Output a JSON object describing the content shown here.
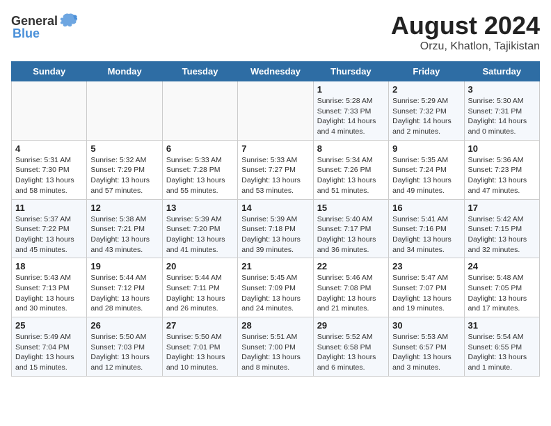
{
  "logo": {
    "text_general": "General",
    "text_blue": "Blue"
  },
  "title": {
    "month_year": "August 2024",
    "location": "Orzu, Khatlon, Tajikistan"
  },
  "days_of_week": [
    "Sunday",
    "Monday",
    "Tuesday",
    "Wednesday",
    "Thursday",
    "Friday",
    "Saturday"
  ],
  "weeks": [
    [
      {
        "day": "",
        "info": ""
      },
      {
        "day": "",
        "info": ""
      },
      {
        "day": "",
        "info": ""
      },
      {
        "day": "",
        "info": ""
      },
      {
        "day": "1",
        "info": "Sunrise: 5:28 AM\nSunset: 7:33 PM\nDaylight: 14 hours\nand 4 minutes."
      },
      {
        "day": "2",
        "info": "Sunrise: 5:29 AM\nSunset: 7:32 PM\nDaylight: 14 hours\nand 2 minutes."
      },
      {
        "day": "3",
        "info": "Sunrise: 5:30 AM\nSunset: 7:31 PM\nDaylight: 14 hours\nand 0 minutes."
      }
    ],
    [
      {
        "day": "4",
        "info": "Sunrise: 5:31 AM\nSunset: 7:30 PM\nDaylight: 13 hours\nand 58 minutes."
      },
      {
        "day": "5",
        "info": "Sunrise: 5:32 AM\nSunset: 7:29 PM\nDaylight: 13 hours\nand 57 minutes."
      },
      {
        "day": "6",
        "info": "Sunrise: 5:33 AM\nSunset: 7:28 PM\nDaylight: 13 hours\nand 55 minutes."
      },
      {
        "day": "7",
        "info": "Sunrise: 5:33 AM\nSunset: 7:27 PM\nDaylight: 13 hours\nand 53 minutes."
      },
      {
        "day": "8",
        "info": "Sunrise: 5:34 AM\nSunset: 7:26 PM\nDaylight: 13 hours\nand 51 minutes."
      },
      {
        "day": "9",
        "info": "Sunrise: 5:35 AM\nSunset: 7:24 PM\nDaylight: 13 hours\nand 49 minutes."
      },
      {
        "day": "10",
        "info": "Sunrise: 5:36 AM\nSunset: 7:23 PM\nDaylight: 13 hours\nand 47 minutes."
      }
    ],
    [
      {
        "day": "11",
        "info": "Sunrise: 5:37 AM\nSunset: 7:22 PM\nDaylight: 13 hours\nand 45 minutes."
      },
      {
        "day": "12",
        "info": "Sunrise: 5:38 AM\nSunset: 7:21 PM\nDaylight: 13 hours\nand 43 minutes."
      },
      {
        "day": "13",
        "info": "Sunrise: 5:39 AM\nSunset: 7:20 PM\nDaylight: 13 hours\nand 41 minutes."
      },
      {
        "day": "14",
        "info": "Sunrise: 5:39 AM\nSunset: 7:18 PM\nDaylight: 13 hours\nand 39 minutes."
      },
      {
        "day": "15",
        "info": "Sunrise: 5:40 AM\nSunset: 7:17 PM\nDaylight: 13 hours\nand 36 minutes."
      },
      {
        "day": "16",
        "info": "Sunrise: 5:41 AM\nSunset: 7:16 PM\nDaylight: 13 hours\nand 34 minutes."
      },
      {
        "day": "17",
        "info": "Sunrise: 5:42 AM\nSunset: 7:15 PM\nDaylight: 13 hours\nand 32 minutes."
      }
    ],
    [
      {
        "day": "18",
        "info": "Sunrise: 5:43 AM\nSunset: 7:13 PM\nDaylight: 13 hours\nand 30 minutes."
      },
      {
        "day": "19",
        "info": "Sunrise: 5:44 AM\nSunset: 7:12 PM\nDaylight: 13 hours\nand 28 minutes."
      },
      {
        "day": "20",
        "info": "Sunrise: 5:44 AM\nSunset: 7:11 PM\nDaylight: 13 hours\nand 26 minutes."
      },
      {
        "day": "21",
        "info": "Sunrise: 5:45 AM\nSunset: 7:09 PM\nDaylight: 13 hours\nand 24 minutes."
      },
      {
        "day": "22",
        "info": "Sunrise: 5:46 AM\nSunset: 7:08 PM\nDaylight: 13 hours\nand 21 minutes."
      },
      {
        "day": "23",
        "info": "Sunrise: 5:47 AM\nSunset: 7:07 PM\nDaylight: 13 hours\nand 19 minutes."
      },
      {
        "day": "24",
        "info": "Sunrise: 5:48 AM\nSunset: 7:05 PM\nDaylight: 13 hours\nand 17 minutes."
      }
    ],
    [
      {
        "day": "25",
        "info": "Sunrise: 5:49 AM\nSunset: 7:04 PM\nDaylight: 13 hours\nand 15 minutes."
      },
      {
        "day": "26",
        "info": "Sunrise: 5:50 AM\nSunset: 7:03 PM\nDaylight: 13 hours\nand 12 minutes."
      },
      {
        "day": "27",
        "info": "Sunrise: 5:50 AM\nSunset: 7:01 PM\nDaylight: 13 hours\nand 10 minutes."
      },
      {
        "day": "28",
        "info": "Sunrise: 5:51 AM\nSunset: 7:00 PM\nDaylight: 13 hours\nand 8 minutes."
      },
      {
        "day": "29",
        "info": "Sunrise: 5:52 AM\nSunset: 6:58 PM\nDaylight: 13 hours\nand 6 minutes."
      },
      {
        "day": "30",
        "info": "Sunrise: 5:53 AM\nSunset: 6:57 PM\nDaylight: 13 hours\nand 3 minutes."
      },
      {
        "day": "31",
        "info": "Sunrise: 5:54 AM\nSunset: 6:55 PM\nDaylight: 13 hours\nand 1 minute."
      }
    ]
  ]
}
